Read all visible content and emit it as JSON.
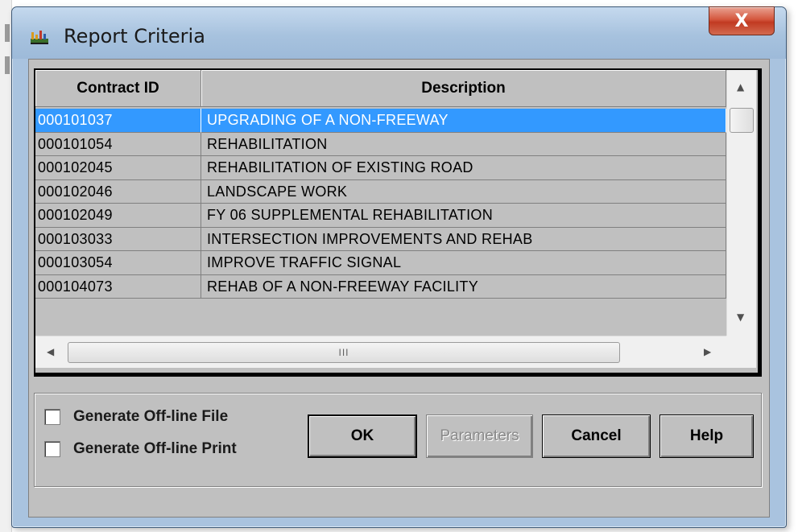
{
  "window": {
    "title": "Report Criteria",
    "close_label": "X"
  },
  "grid": {
    "columns": [
      "Contract ID",
      "Description"
    ],
    "rows": [
      {
        "id": "000101037",
        "description": "UPGRADING OF A NON-FREEWAY",
        "selected": true
      },
      {
        "id": "000101054",
        "description": "REHABILITATION",
        "selected": false
      },
      {
        "id": "000102045",
        "description": "REHABILITATION OF EXISTING ROAD",
        "selected": false
      },
      {
        "id": "000102046",
        "description": "LANDSCAPE WORK",
        "selected": false
      },
      {
        "id": "000102049",
        "description": "FY 06 SUPPLEMENTAL REHABILITATION",
        "selected": false
      },
      {
        "id": "000103033",
        "description": "INTERSECTION IMPROVEMENTS AND REHAB",
        "selected": false
      },
      {
        "id": "000103054",
        "description": "IMPROVE TRAFFIC SIGNAL",
        "selected": false
      },
      {
        "id": "000104073",
        "description": "REHAB OF A NON-FREEWAY FACILITY",
        "selected": false
      }
    ],
    "hscroll_grip": "III"
  },
  "options": {
    "offline_file_label": "Generate Off-line File",
    "offline_file_checked": false,
    "offline_print_label": "Generate Off-line Print",
    "offline_print_checked": false
  },
  "buttons": {
    "ok": "OK",
    "parameters": "Parameters",
    "cancel": "Cancel",
    "help": "Help"
  },
  "icons": {
    "app": "report-app-icon",
    "close": "close-icon",
    "scroll_up": "arrow-up-icon",
    "scroll_down": "arrow-down-icon",
    "scroll_left": "arrow-left-icon",
    "scroll_right": "arrow-right-icon"
  },
  "colors": {
    "selection": "#3399ff",
    "dialog_face": "#c0c0c0",
    "frame": "#a9c3df",
    "close_button": "#d4563d"
  }
}
